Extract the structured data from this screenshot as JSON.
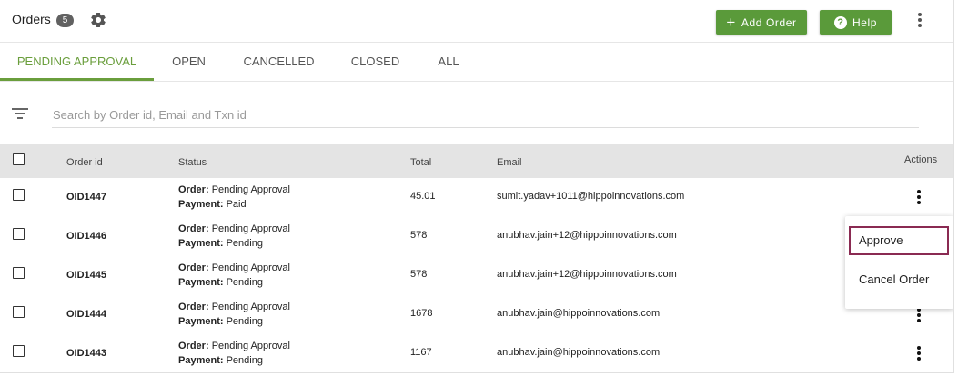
{
  "header": {
    "title": "Orders",
    "count": "5",
    "add_order_label": "Add Order",
    "help_label": "Help"
  },
  "tabs": [
    {
      "label": "PENDING APPROVAL",
      "active": true
    },
    {
      "label": "OPEN",
      "active": false
    },
    {
      "label": "CANCELLED",
      "active": false
    },
    {
      "label": "CLOSED",
      "active": false
    },
    {
      "label": "ALL",
      "active": false
    }
  ],
  "search": {
    "placeholder": "Search by Order id, Email and Txn id",
    "value": ""
  },
  "table": {
    "columns": {
      "order_id": "Order id",
      "status": "Status",
      "total": "Total",
      "email": "Email",
      "actions": "Actions"
    },
    "status_order_label": "Order:",
    "status_payment_label": "Payment:",
    "rows": [
      {
        "order_id": "OID1447",
        "order_status": "Pending Approval",
        "payment_status": "Paid",
        "total": "45.01",
        "email": "sumit.yadav+1011@hippoinnovations.com"
      },
      {
        "order_id": "OID1446",
        "order_status": "Pending Approval",
        "payment_status": "Pending",
        "total": "578",
        "email": "anubhav.jain+12@hippoinnovations.com"
      },
      {
        "order_id": "OID1445",
        "order_status": "Pending Approval",
        "payment_status": "Pending",
        "total": "578",
        "email": "anubhav.jain+12@hippoinnovations.com"
      },
      {
        "order_id": "OID1444",
        "order_status": "Pending Approval",
        "payment_status": "Pending",
        "total": "1678",
        "email": "anubhav.jain@hippoinnovations.com"
      },
      {
        "order_id": "OID1443",
        "order_status": "Pending Approval",
        "payment_status": "Pending",
        "total": "1167",
        "email": "anubhav.jain@hippoinnovations.com"
      }
    ]
  },
  "action_menu": {
    "items": [
      {
        "label": "Approve",
        "selected": true
      },
      {
        "label": "Cancel Order",
        "selected": false
      }
    ]
  },
  "icons": {
    "settings": "gear-icon",
    "add": "plus-icon",
    "help": "help-circle-icon",
    "more": "kebab-menu-icon",
    "filter": "filter-icon"
  },
  "colors": {
    "accent_green": "#5a9a3a",
    "active_tab": "#6a9e3c",
    "menu_highlight": "#8a2a52",
    "badge": "#616161"
  }
}
